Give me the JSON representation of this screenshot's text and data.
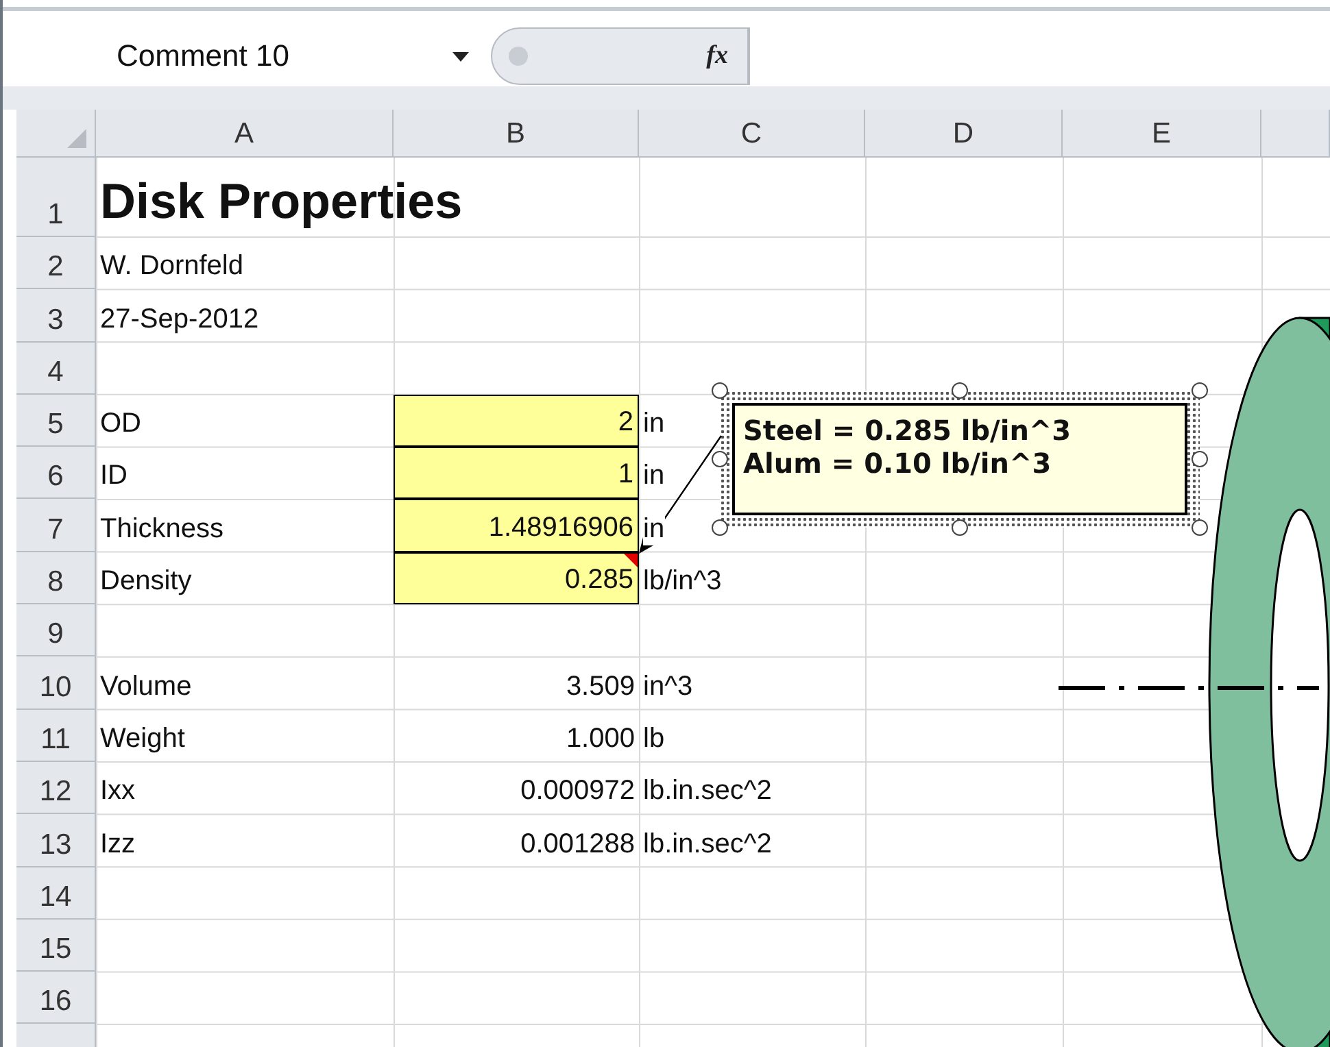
{
  "name_box": {
    "value": "Comment 10"
  },
  "formula_bar": {
    "function_label": "fx"
  },
  "columns": [
    "A",
    "B",
    "C",
    "D",
    "E"
  ],
  "rows": [
    {
      "number": "1",
      "kind": "title",
      "label": "Disk Properties"
    },
    {
      "number": "2",
      "kind": "text",
      "label": "W. Dornfeld"
    },
    {
      "number": "3",
      "kind": "text",
      "label": "27-Sep-2012"
    },
    {
      "number": "4",
      "kind": "blank"
    },
    {
      "number": "5",
      "kind": "value",
      "label": "OD",
      "value": "2",
      "unit": "in",
      "input": true,
      "comment": false
    },
    {
      "number": "6",
      "kind": "value",
      "label": "ID",
      "value": "1",
      "unit": "in",
      "input": true,
      "comment": false
    },
    {
      "number": "7",
      "kind": "value",
      "label": "Thickness",
      "value": "1.48916906",
      "unit": "in",
      "input": true,
      "comment": false
    },
    {
      "number": "8",
      "kind": "value",
      "label": "Density",
      "value": "0.285",
      "unit": "lb/in^3",
      "input": true,
      "comment": true
    },
    {
      "number": "9",
      "kind": "blank"
    },
    {
      "number": "10",
      "kind": "value",
      "label": "Volume",
      "value": "3.509",
      "unit": "in^3",
      "input": false,
      "comment": false
    },
    {
      "number": "11",
      "kind": "value",
      "label": "Weight",
      "value": "1.000",
      "unit": "lb",
      "input": false,
      "comment": false
    },
    {
      "number": "12",
      "kind": "value",
      "label": "Ixx",
      "value": "0.000972",
      "unit": "lb.in.sec^2",
      "input": false,
      "comment": false
    },
    {
      "number": "13",
      "kind": "value",
      "label": "Izz",
      "value": "0.001288",
      "unit": "lb.in.sec^2",
      "input": false,
      "comment": false
    },
    {
      "number": "14",
      "kind": "blank"
    },
    {
      "number": "15",
      "kind": "blank"
    },
    {
      "number": "16",
      "kind": "blank"
    }
  ],
  "comment": {
    "lines": [
      "Steel = 0.285 lb/in^3",
      "Alum = 0.10 lb/in^3"
    ]
  }
}
